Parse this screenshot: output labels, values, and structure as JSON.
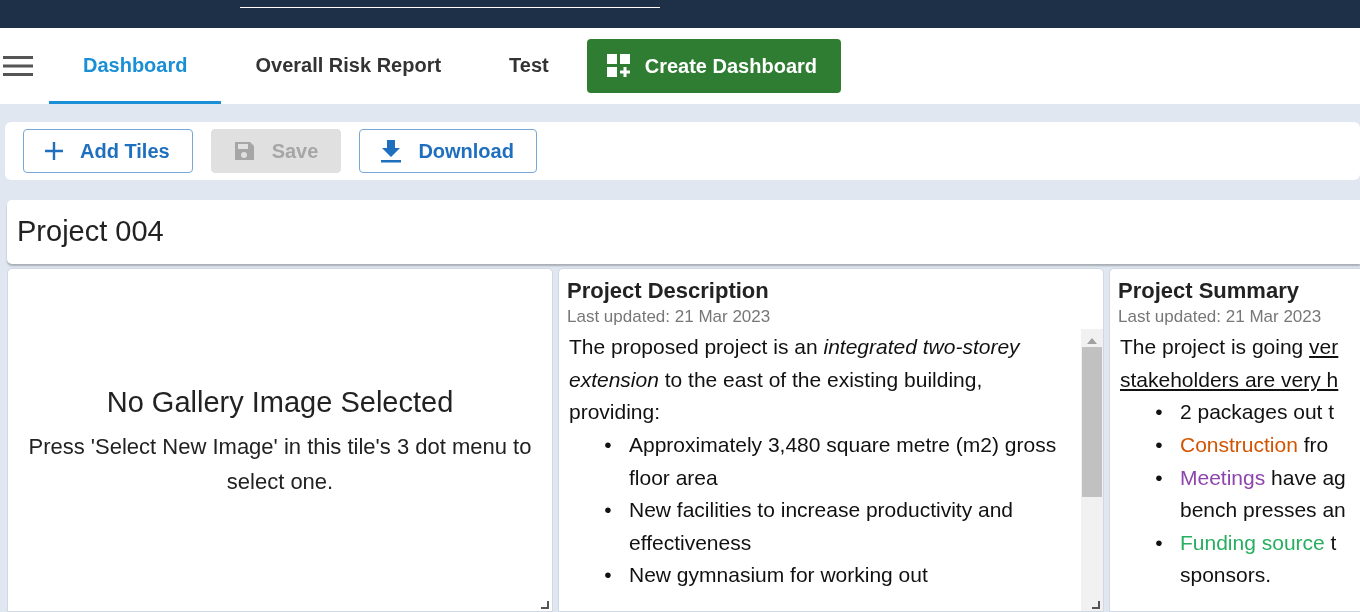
{
  "tabs": [
    {
      "label": "Dashboard",
      "selected": true
    },
    {
      "label": "Overall Risk Report",
      "selected": false
    },
    {
      "label": "Test",
      "selected": false
    }
  ],
  "create_button": "Create Dashboard",
  "toolbar": [
    {
      "kind": "add",
      "label": "Add Tiles",
      "disabled": false
    },
    {
      "kind": "save",
      "label": "Save",
      "disabled": true
    },
    {
      "kind": "download",
      "label": "Download",
      "disabled": false
    }
  ],
  "dashboard_title": "Project 004",
  "gallery_tile": {
    "title": "No Gallery Image Selected",
    "message": "Press 'Select New Image' in this tile's 3 dot menu to select one."
  },
  "description_tile": {
    "title": "Project Description",
    "updated": "Last updated: 21 Mar 2023",
    "paragraph": "The proposed project is an *integrated two-storey extension* to the east of the existing building, providing:",
    "bullets": [
      {
        "marker": "•",
        "text": "Approximately 3,480 square metre (m2) gross floor area"
      },
      {
        "marker": "•",
        "text": "New facilities to increase productivity and effectiveness"
      },
      {
        "marker": "•",
        "text": "New gymnasium for working out"
      }
    ]
  },
  "summary_tile": {
    "title": "Project Summary",
    "updated": "Last updated: 21 Mar 2023",
    "paragraph_lines": [
      [
        {
          "text": "The project is going ",
          "underline": false
        },
        {
          "text": "ver",
          "underline": true
        }
      ],
      [
        {
          "text": "stakeholders are very h",
          "underline": true
        }
      ]
    ],
    "bullets": [
      {
        "marker": "•",
        "lines": [
          [
            {
              "text": "2 packages out t"
            }
          ]
        ]
      },
      {
        "marker": "•",
        "lines": [
          [
            {
              "text": "Construction",
              "color": "#d35400"
            },
            {
              "text": " fro"
            }
          ]
        ]
      },
      {
        "marker": "•",
        "lines": [
          [
            {
              "text": "Meetings",
              "color": "#8e44ad"
            },
            {
              "text": " have ag"
            }
          ],
          [
            {
              "text": "bench presses an"
            }
          ]
        ]
      },
      {
        "marker": "•",
        "lines": [
          [
            {
              "text": "Funding source",
              "color": "#27ae60"
            },
            {
              "text": " t"
            }
          ],
          [
            {
              "text": "sponsors."
            }
          ]
        ]
      }
    ]
  }
}
